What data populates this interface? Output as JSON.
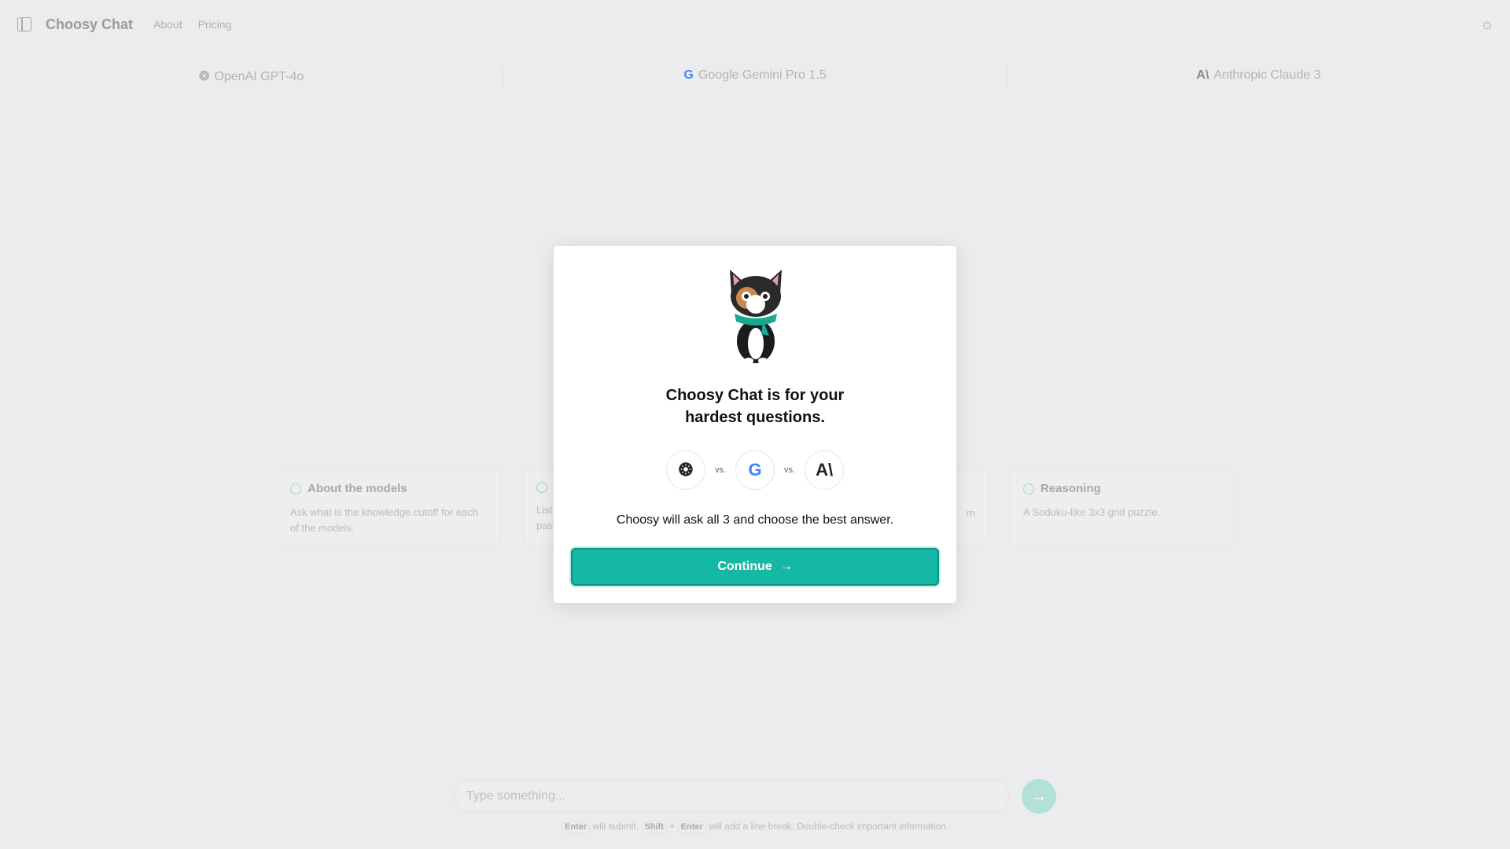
{
  "header": {
    "title": "Choosy Chat",
    "nav": [
      "About",
      "Pricing"
    ]
  },
  "models": [
    {
      "name": "OpenAI GPT-4o",
      "icon": "openai-icon"
    },
    {
      "name": "Google Gemini Pro 1.5",
      "icon": "google-icon"
    },
    {
      "name": "Anthropic Claude 3",
      "icon": "anthropic-icon"
    }
  ],
  "cards": [
    {
      "title": "About the models",
      "desc": "Ask what is the knowledge cutoff for each of the models."
    },
    {
      "title": "",
      "desc": "List past"
    },
    {
      "title": "",
      "desc": "rn"
    },
    {
      "title": "Reasoning",
      "desc": "A Soduku-like 3x3 grid puzzle."
    }
  ],
  "modal": {
    "title_line1": "Choosy Chat is for your",
    "title_line2": "hardest questions.",
    "vs": "vs.",
    "subtitle": "Choosy will ask all 3 and choose the best answer.",
    "continue": "Continue"
  },
  "input": {
    "placeholder": "Type something..."
  },
  "hint": {
    "k1": "Enter",
    "t1": "will submit.",
    "k2": "Shift",
    "plus": "+",
    "k3": "Enter",
    "t2": "will add a line break. Double-check important information."
  },
  "colors": {
    "accent": "#15b8a4",
    "background": "#ececee"
  }
}
